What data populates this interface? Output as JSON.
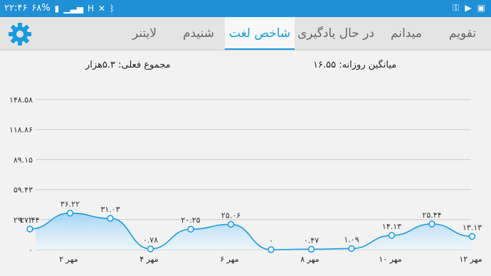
{
  "status_bar": {
    "time": "۲۲:۴۶",
    "battery": "۶۸%",
    "icons": [
      "battery-icon",
      "signal-icon",
      "network-icon",
      "bluetooth-icon",
      "key-icon",
      "youtube-icon",
      "gallery-icon"
    ]
  },
  "tabs": [
    {
      "label": "لایتنر",
      "active": false
    },
    {
      "label": "شنیدم",
      "active": false
    },
    {
      "label": "شاخص لغت",
      "active": true
    },
    {
      "label": "در حال یادگیری",
      "active": false
    },
    {
      "label": "میدانم",
      "active": false
    },
    {
      "label": "تقویم",
      "active": false
    }
  ],
  "summary": {
    "total": "مجموع فعلی: ۵.۳هزار",
    "daily_average": "میانگین روزانه: ۱۶.۵۵"
  },
  "colors": {
    "accent": "#1a9be0",
    "statusbar": "#1f8fd6",
    "fill": "#bfe0f7"
  },
  "chart_data": {
    "type": "area",
    "y_ticks": [
      "۱۴۸.۵۸",
      "۱۱۸.۸۶",
      "۸۹.۱۵",
      "۵۹.۴۳",
      "۲۹.۷۲",
      "۰"
    ],
    "ylim": [
      0,
      148.58
    ],
    "x_tick_labels": [
      "۲ مهر",
      "۴ مهر",
      "۶ مهر",
      "۸ مهر",
      "۱۰ مهر",
      "۱۲ مهر"
    ],
    "x_tick_index": [
      1,
      3,
      5,
      7,
      9,
      11
    ],
    "values": [
      20.44,
      36.22,
      31.03,
      0.78,
      20.25,
      25.06,
      0,
      0.47,
      1.09,
      14.13,
      25.44,
      13.13
    ],
    "labels": [
      "۲۰.۴۴",
      "۳۶.۲۲",
      "۳۱.۰۳",
      "۰.۷۸",
      "۲۰.۲۵",
      "۲۵.۰۶",
      "۰",
      "۰.۴۷",
      "۱.۰۹",
      "۱۴.۱۳",
      "۲۵.۴۴",
      "۱۳.۱۳"
    ],
    "grid": true,
    "xlabel": "",
    "ylabel": ""
  }
}
